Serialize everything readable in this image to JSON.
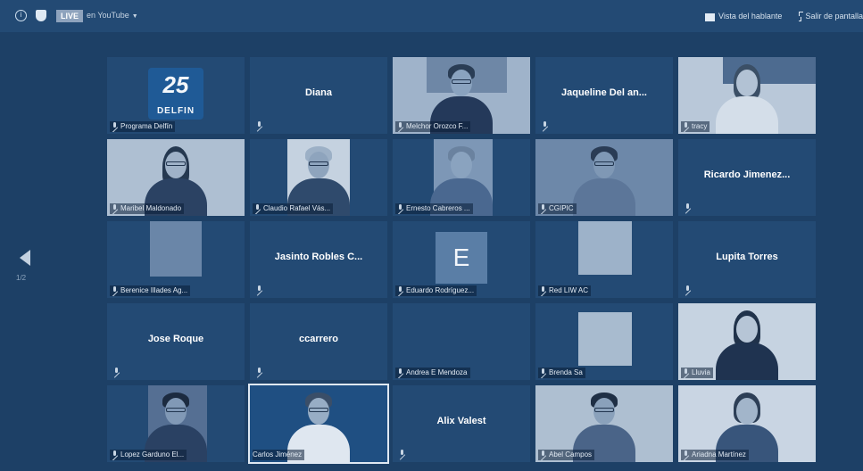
{
  "top_bar": {
    "live_badge": "LIVE",
    "stream_target": "en YouTube",
    "view_button": "Vista del hablante",
    "fullscreen_button": "Salir de pantalla"
  },
  "pagination": {
    "indicator": "1/2"
  },
  "participants": [
    {
      "label": "Programa Delfín",
      "display": "",
      "type": "logo",
      "logo_number": "25",
      "logo_text": "DELFIN"
    },
    {
      "label": "",
      "display": "Diana",
      "type": "name"
    },
    {
      "label": "Melchor Orozco F...",
      "display": "",
      "type": "video"
    },
    {
      "label": "",
      "display": "Jaqueline Del an...",
      "type": "name"
    },
    {
      "label": "tracy",
      "display": "",
      "type": "video"
    },
    {
      "label": "Maribel Maldonado",
      "display": "",
      "type": "video"
    },
    {
      "label": "Claudio Rafael Vás...",
      "display": "",
      "type": "video"
    },
    {
      "label": "Ernesto Cabreros ...",
      "display": "",
      "type": "video"
    },
    {
      "label": "CGIPIC",
      "display": "",
      "type": "video"
    },
    {
      "label": "",
      "display": "Ricardo Jimenez...",
      "type": "name"
    },
    {
      "label": "Berenice Illades Ag...",
      "display": "",
      "type": "video"
    },
    {
      "label": "",
      "display": "Jasinto Robles C...",
      "type": "name"
    },
    {
      "label": "Eduardo Rodríguez...",
      "display": "",
      "type": "avatar",
      "avatar_letter": "E"
    },
    {
      "label": "Red LIW AC",
      "display": "",
      "type": "video"
    },
    {
      "label": "",
      "display": "Lupita Torres",
      "type": "name"
    },
    {
      "label": "",
      "display": "Jose Roque",
      "type": "name"
    },
    {
      "label": "",
      "display": "ccarrero",
      "type": "name"
    },
    {
      "label": "Andrea E Mendoza",
      "display": "",
      "type": "empty"
    },
    {
      "label": "Brenda Sa",
      "display": "",
      "type": "video"
    },
    {
      "label": "Lluvia",
      "display": "",
      "type": "video"
    },
    {
      "label": "Lopez Garduno El...",
      "display": "",
      "type": "video"
    },
    {
      "label": "Carlos Jiménez",
      "display": "",
      "type": "video",
      "active": true
    },
    {
      "label": "",
      "display": "Alix Valest",
      "type": "name"
    },
    {
      "label": "Abel Campos",
      "display": "",
      "type": "video"
    },
    {
      "label": "Ariadna Martínez",
      "display": "",
      "type": "video"
    }
  ]
}
